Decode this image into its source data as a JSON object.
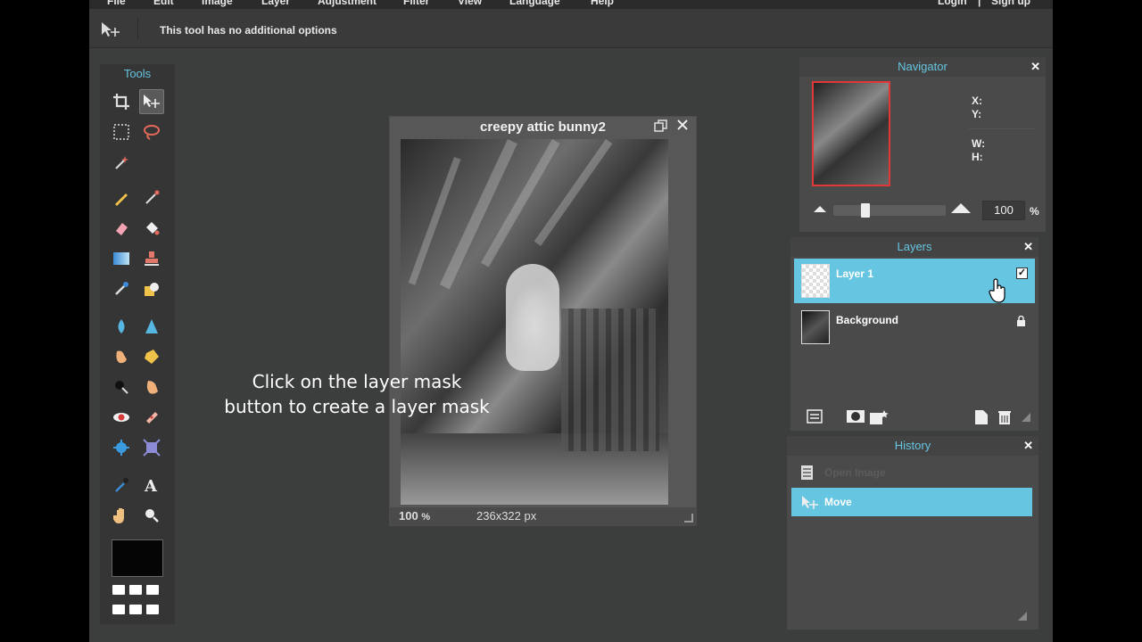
{
  "menu": {
    "items": [
      "File",
      "Edit",
      "Image",
      "Layer",
      "Adjustment",
      "Filter",
      "View",
      "Language",
      "Help"
    ],
    "login": "Login",
    "separator": "|",
    "signup": "Sign up"
  },
  "options_bar": {
    "message": "This tool has no additional options"
  },
  "tools": {
    "title": "Tools",
    "icons": [
      "crop-icon",
      "move-icon",
      "marquee-icon",
      "lasso-icon",
      "magic-wand-icon",
      "pencil-icon",
      "brush-icon",
      "eraser-icon",
      "paint-bucket-icon",
      "gradient-icon",
      "clone-stamp-icon",
      "color-replace-icon",
      "drawing-icon",
      "blur-icon",
      "sharpen-icon",
      "smudge-icon",
      "sponge-icon",
      "dodge-icon",
      "burn-icon",
      "red-eye-icon",
      "spot-heal-icon",
      "bloat-icon",
      "pinch-icon",
      "color-picker-icon",
      "type-icon",
      "hand-icon",
      "zoom-icon"
    ],
    "foreground_color": "#050505"
  },
  "image_window": {
    "title": "creepy attic bunny2",
    "zoom": "100",
    "zoom_unit": "%",
    "dimensions": "236x322 px"
  },
  "caption": {
    "line1": "Click on the layer mask",
    "line2": "button to create a layer mask"
  },
  "navigator": {
    "title": "Navigator",
    "x_label": "X:",
    "y_label": "Y:",
    "w_label": "W:",
    "h_label": "H:",
    "zoom_value": "100",
    "zoom_unit": "%",
    "zoom_slider_level": 0.27
  },
  "layers": {
    "title": "Layers",
    "items": [
      {
        "name": "Layer 1",
        "selected": true,
        "visible_checked": true
      },
      {
        "name": "Background",
        "selected": false,
        "locked": true
      }
    ]
  },
  "history": {
    "title": "History",
    "items": [
      {
        "label": "Open Image",
        "selected": false
      },
      {
        "label": "Move",
        "selected": true
      }
    ]
  },
  "colors": {
    "accent": "#66c5e0",
    "panel_bg": "#4a4a4a",
    "workspace_bg": "#3c3d3d"
  }
}
